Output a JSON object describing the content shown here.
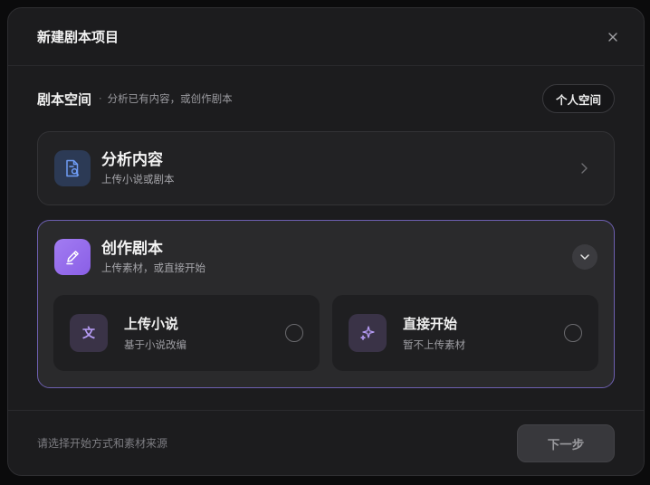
{
  "dialog": {
    "title": "新建剧本项目",
    "close_label": "×"
  },
  "section": {
    "title": "剧本空间",
    "separator": "·",
    "subtitle": "分析已有内容，或创作剧本",
    "space_button_label": "个人空间"
  },
  "cards": {
    "analyze": {
      "title": "分析内容",
      "subtitle": "上传小说或剧本",
      "icon": "document-search-icon"
    },
    "create": {
      "title": "创作剧本",
      "subtitle": "上传素材，或直接开始",
      "icon": "pen-edit-icon",
      "expanded": true,
      "options": [
        {
          "title": "上传小说",
          "subtitle": "基于小说改编",
          "icon_glyph": "文",
          "icon": "text-icon",
          "selected": false
        },
        {
          "title": "直接开始",
          "subtitle": "暂不上传素材",
          "icon": "sparkle-icon",
          "selected": false
        }
      ]
    }
  },
  "footer": {
    "hint": "请选择开始方式和素材来源",
    "next_label": "下一步",
    "next_disabled": true
  },
  "colors": {
    "accent": "#8f6ae8",
    "selected_border": "#6d5fb0",
    "background": "#1c1c1e"
  }
}
